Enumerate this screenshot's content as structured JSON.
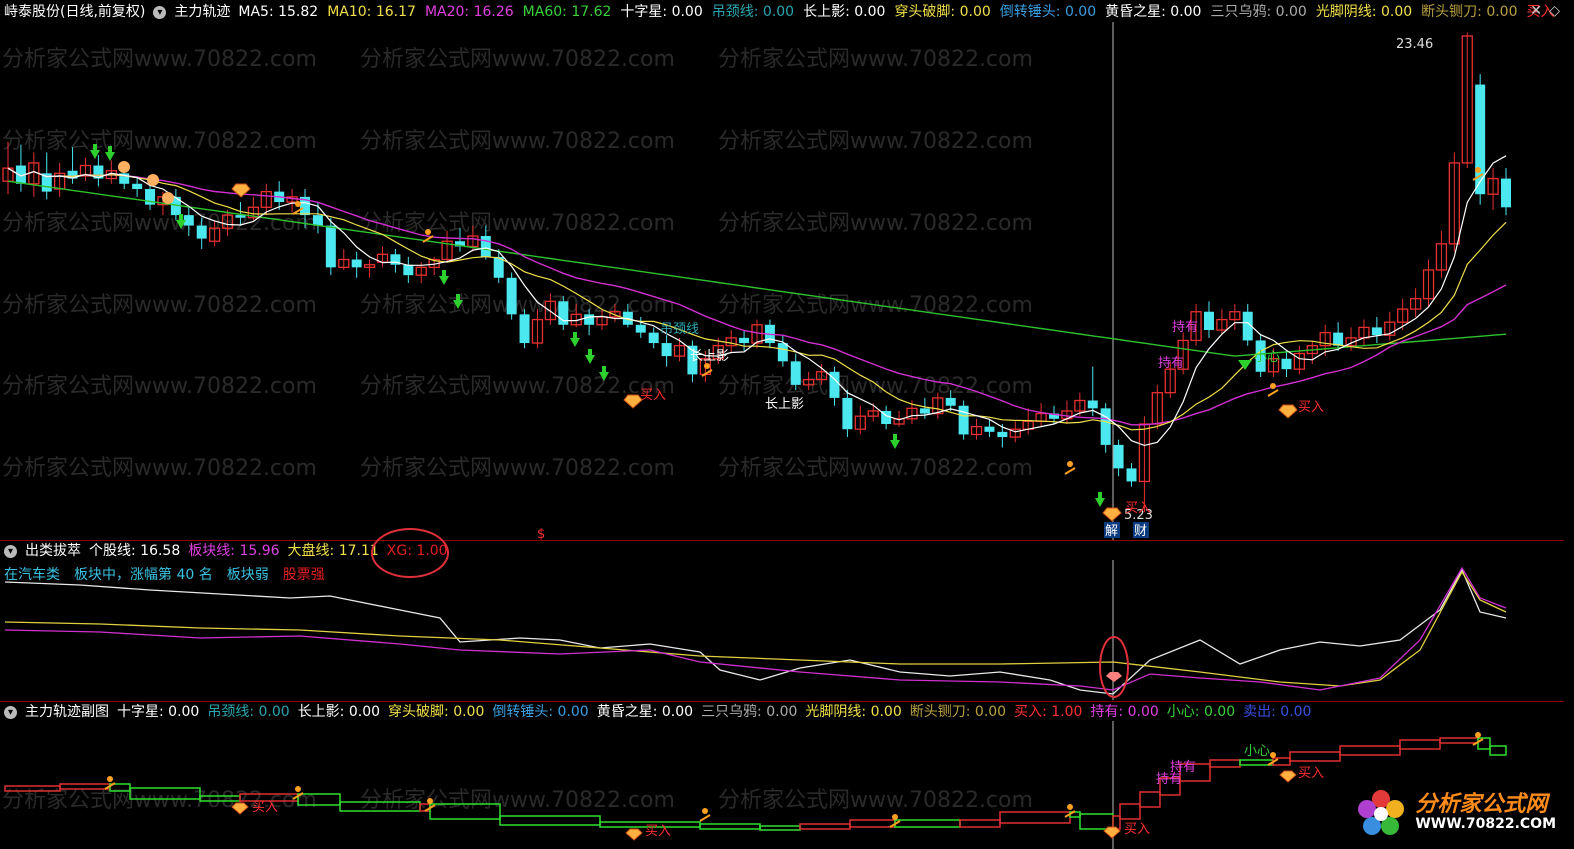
{
  "main_header": {
    "stock": "峙泰股份(日线,前复权)",
    "indicator": "主力轨迹",
    "items": [
      {
        "label": "MA5: ",
        "value": "15.82",
        "color": "#ffffff"
      },
      {
        "label": "MA10: ",
        "value": "16.17",
        "color": "#f0e04a"
      },
      {
        "label": "MA20: ",
        "value": "16.26",
        "color": "#e040e0"
      },
      {
        "label": "MA60: ",
        "value": "17.62",
        "color": "#3ad03a"
      },
      {
        "label": "十字星: ",
        "value": "0.00",
        "color": "#ffffff"
      },
      {
        "label": "吊颈线: ",
        "value": "0.00",
        "color": "#2aa6b0"
      },
      {
        "label": "长上影: ",
        "value": "0.00",
        "color": "#ffffff"
      },
      {
        "label": "穿头破脚: ",
        "value": "0.00",
        "color": "#f0e04a"
      },
      {
        "label": "倒转锤头: ",
        "value": "0.00",
        "color": "#3a9ee0"
      },
      {
        "label": "黄昏之星: ",
        "value": "0.00",
        "color": "#ffffff"
      },
      {
        "label": "三只乌鸦: ",
        "value": "0.00",
        "color": "#aaaaaa"
      },
      {
        "label": "光脚阴线: ",
        "value": "0.00",
        "color": "#f0e04a"
      },
      {
        "label": "断头铡刀: ",
        "value": "0.00",
        "color": "#b8a040"
      },
      {
        "label": "买入",
        "value": "",
        "color": "#ff3030"
      }
    ],
    "right_icons": [
      "close-icon",
      "diamond-icon"
    ]
  },
  "main_chart": {
    "high_label": "23.46",
    "low_label": "5.23",
    "markers": {
      "buy": "买入",
      "hold": "持有",
      "careful": "小心",
      "hanging": "吊颈线",
      "long_shadow": "长上影",
      "dollar": "$",
      "jie": "解",
      "cai": "财"
    }
  },
  "sub1_header": {
    "name": "出类拔萃",
    "items": [
      {
        "label": "个股线: ",
        "value": "16.58",
        "color": "#ffffff"
      },
      {
        "label": "板块线: ",
        "value": "15.96",
        "color": "#e040e0"
      },
      {
        "label": "大盘线: ",
        "value": "17.11",
        "color": "#f0e04a"
      },
      {
        "label": "XG: ",
        "value": "1.00",
        "color": "#e02020"
      }
    ],
    "info": [
      {
        "text": "在汽车类",
        "color": "#3ac0e0"
      },
      {
        "text": "板块中，涨幅第 40 名",
        "color": "#3ac0e0"
      },
      {
        "text": "板块弱",
        "color": "#3ac0e0"
      },
      {
        "text": "股票强",
        "color": "#e02020"
      }
    ]
  },
  "sub2_header": {
    "name": "主力轨迹副图",
    "items": [
      {
        "label": "十字星: ",
        "value": "0.00",
        "color": "#ffffff"
      },
      {
        "label": "吊颈线: ",
        "value": "0.00",
        "color": "#2aa6b0"
      },
      {
        "label": "长上影: ",
        "value": "0.00",
        "color": "#ffffff"
      },
      {
        "label": "穿头破脚: ",
        "value": "0.00",
        "color": "#f0e04a"
      },
      {
        "label": "倒转锤头: ",
        "value": "0.00",
        "color": "#3a9ee0"
      },
      {
        "label": "黄昏之星: ",
        "value": "0.00",
        "color": "#ffffff"
      },
      {
        "label": "三只乌鸦: ",
        "value": "0.00",
        "color": "#aaaaaa"
      },
      {
        "label": "光脚阴线: ",
        "value": "0.00",
        "color": "#f0e04a"
      },
      {
        "label": "断头铡刀: ",
        "value": "0.00",
        "color": "#b8a040"
      },
      {
        "label": "买入: ",
        "value": "1.00",
        "color": "#ff3030"
      },
      {
        "label": "持有: ",
        "value": "0.00",
        "color": "#e040e0"
      },
      {
        "label": "小心: ",
        "value": "0.00",
        "color": "#3ad03a"
      },
      {
        "label": "卖出: ",
        "value": "0.00",
        "color": "#3a50e0"
      }
    ]
  },
  "watermark": "分析家公式网www.70822.com",
  "logo": {
    "text": "分析家公式网",
    "url": "WWW.70822.COM"
  },
  "colors": {
    "up": "#e83030",
    "down": "#4ce8f0",
    "ma5": "#ffffff",
    "ma10": "#f0e04a",
    "ma20": "#d030d0",
    "ma60": "#2ec02e"
  }
}
